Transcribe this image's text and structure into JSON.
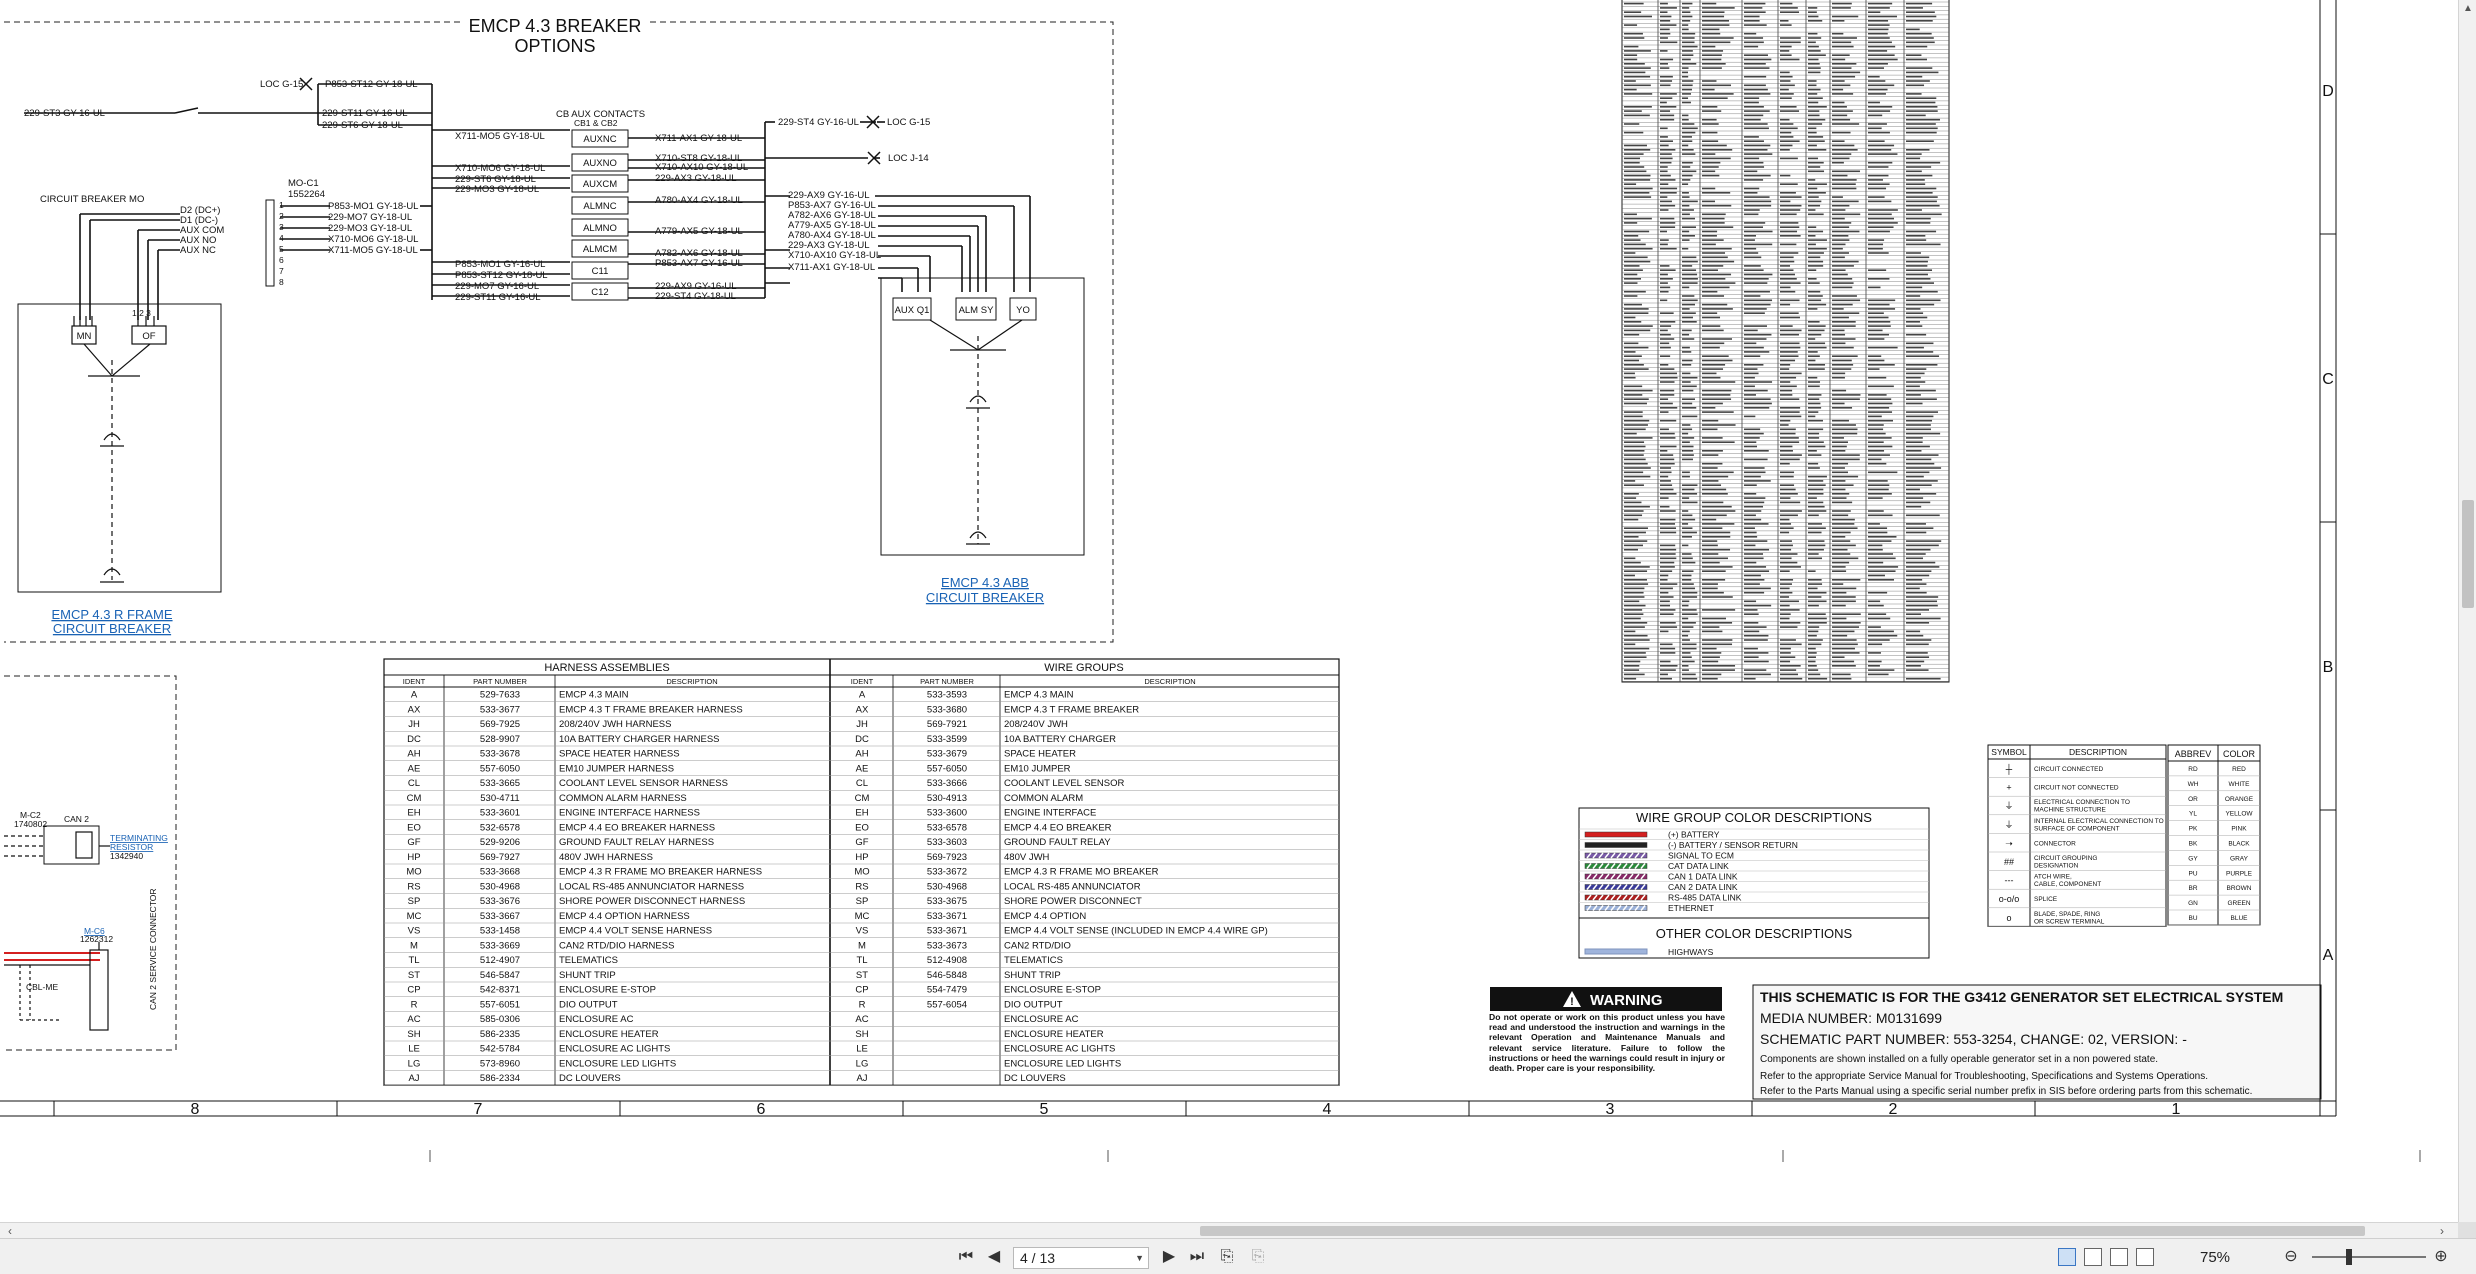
{
  "breaker_options": {
    "title_line1": "EMCP 4.3 BREAKER",
    "title_line2": "OPTIONS",
    "r_frame_link_line1": "EMCP 4.3 R FRAME",
    "r_frame_link_line2": "CIRCUIT BREAKER",
    "abb_link_line1": "EMCP 4.3 ABB",
    "abb_link_line2": "CIRCUIT BREAKER",
    "circuit_breaker_mo": "CIRCUIT BREAKER MO",
    "mo_c1_line1": "MO-C1",
    "mo_c1_line2": "1552264",
    "cb_aux_line1": "CB AUX CONTACTS",
    "cb_aux_line2": "CB1 & CB2",
    "loc_g15": "LOC G-15",
    "loc_j14": "LOC J-14",
    "mo_pins": [
      "D2 (DC+)",
      "D1 (DC-)",
      "AUX COM",
      "AUX NO",
      "AUX NC"
    ],
    "terminal_numbers": [
      "1",
      "2",
      "3",
      "4",
      "5",
      "6",
      "7",
      "8"
    ],
    "mo_wires": [
      "P853-MO1 GY-18-UL",
      "229-MO7 GY-18-UL",
      "229-MO3 GY-18-UL",
      "X710-MO6 GY-18-UL",
      "X711-MO5 GY-18-UL"
    ],
    "top_wires": [
      "P853-ST12 GY-18-UL",
      "229-ST11 GY-16-UL",
      "229-ST6 GY-18-UL",
      "229-ST3 GY-16-UL"
    ],
    "aux_boxes": [
      "AUXNC",
      "AUXNO",
      "AUXCM",
      "ALMNC",
      "ALMNO",
      "ALMCM",
      "C11",
      "C12"
    ],
    "left_aux_wires": [
      "X711-MO5 GY-18-UL",
      "X710-MO6 GY-18-UL",
      "229-ST6 GY-18-UL",
      "229-MO3 GY-18-UL",
      "P853-MO1 GY-16-UL",
      "P853-ST12 GY-18-UL",
      "229-MO7 GY-16-UL",
      "229-ST11 GY-16-UL"
    ],
    "right_aux_wires": [
      "X711-AX1 GY-18-UL",
      "X710-ST8 GY-18-UL",
      "X710-AX10 GY-18-UL",
      "229-AX3 GY-18-UL",
      "A780-AX4 GY-18-UL",
      "A779-AX5 GY-18-UL",
      "A782-AX6 GY-18-UL",
      "P853-AX7 GY-16-UL",
      "229-AX9 GY-16-UL",
      "229-ST4 GY-18-UL"
    ],
    "abb_wires": [
      "229-ST4 GY-16-UL",
      "229-AX9 GY-16-UL",
      "P853-AX7 GY-16-UL",
      "A782-AX6 GY-18-UL",
      "A779-AX5 GY-18-UL",
      "A780-AX4 GY-18-UL",
      "229-AX3 GY-18-UL",
      "X710-AX10 GY-18-UL",
      "X711-AX1 GY-18-UL"
    ],
    "mn_label": "MN",
    "of_label": "OF",
    "of_pins": "1 2 3",
    "aux_q1": "AUX Q1",
    "alm_sy": "ALM SY",
    "yo": "YO"
  },
  "left_partial": {
    "mc2_line1": "M-C2",
    "mc2_line2": "1740802",
    "can2": "CAN 2",
    "terminating_line1": "TERMINATING",
    "terminating_line2": "RESISTOR",
    "terminating_pn": "1342940",
    "m_c6": "M-C6",
    "m_c6_pn": "1262312",
    "cbl_me": "CBL-ME",
    "service_connector": "CAN 2 SERVICE CONNECTOR"
  },
  "harness": {
    "title_left": "HARNESS ASSEMBLIES",
    "title_right": "WIRE GROUPS",
    "headers": [
      "IDENT",
      "PART NUMBER",
      "DESCRIPTION",
      "IDENT",
      "PART NUMBER",
      "DESCRIPTION"
    ],
    "rows": [
      [
        "A",
        "529-7633",
        "EMCP 4.3 MAIN",
        "A",
        "533-3593",
        "EMCP 4.3 MAIN"
      ],
      [
        "AX",
        "533-3677",
        "EMCP 4.3 T FRAME BREAKER HARNESS",
        "AX",
        "533-3680",
        "EMCP 4.3 T FRAME BREAKER"
      ],
      [
        "JH",
        "569-7925",
        "208/240V JWH HARNESS",
        "JH",
        "569-7921",
        "208/240V JWH"
      ],
      [
        "DC",
        "528-9907",
        "10A BATTERY CHARGER HARNESS",
        "DC",
        "533-3599",
        "10A BATTERY CHARGER"
      ],
      [
        "AH",
        "533-3678",
        "SPACE HEATER HARNESS",
        "AH",
        "533-3679",
        "SPACE HEATER"
      ],
      [
        "AE",
        "557-6050",
        "EM10 JUMPER HARNESS",
        "AE",
        "557-6050",
        "EM10 JUMPER"
      ],
      [
        "CL",
        "533-3665",
        "COOLANT LEVEL SENSOR HARNESS",
        "CL",
        "533-3666",
        "COOLANT LEVEL SENSOR"
      ],
      [
        "CM",
        "530-4711",
        "COMMON ALARM HARNESS",
        "CM",
        "530-4913",
        "COMMON ALARM"
      ],
      [
        "EH",
        "533-3601",
        "ENGINE INTERFACE HARNESS",
        "EH",
        "533-3600",
        "ENGINE INTERFACE"
      ],
      [
        "EO",
        "532-6578",
        "EMCP 4.4 EO BREAKER HARNESS",
        "EO",
        "533-6578",
        "EMCP 4.4 EO BREAKER"
      ],
      [
        "GF",
        "529-9206",
        "GROUND FAULT RELAY HARNESS",
        "GF",
        "533-3603",
        "GROUND FAULT RELAY"
      ],
      [
        "HP",
        "569-7927",
        "480V JWH HARNESS",
        "HP",
        "569-7923",
        "480V JWH"
      ],
      [
        "MO",
        "533-3668",
        "EMCP 4.3 R FRAME MO BREAKER HARNESS",
        "MO",
        "533-3672",
        "EMCP 4.3 R FRAME MO BREAKER"
      ],
      [
        "RS",
        "530-4968",
        "LOCAL RS-485 ANNUNCIATOR HARNESS",
        "RS",
        "530-4968",
        "LOCAL RS-485 ANNUNCIATOR"
      ],
      [
        "SP",
        "533-3676",
        "SHORE POWER DISCONNECT HARNESS",
        "SP",
        "533-3675",
        "SHORE POWER DISCONNECT"
      ],
      [
        "MC",
        "533-3667",
        "EMCP 4.4 OPTION HARNESS",
        "MC",
        "533-3671",
        "EMCP 4.4 OPTION"
      ],
      [
        "VS",
        "533-1458",
        "EMCP 4.4 VOLT SENSE HARNESS",
        "VS",
        "533-3671",
        "EMCP 4.4 VOLT SENSE (INCLUDED IN EMCP 4.4 WIRE GP)"
      ],
      [
        "M",
        "533-3669",
        "CAN2 RTD/DIO HARNESS",
        "M",
        "533-3673",
        "CAN2 RTD/DIO"
      ],
      [
        "TL",
        "512-4907",
        "TELEMATICS",
        "TL",
        "512-4908",
        "TELEMATICS"
      ],
      [
        "ST",
        "546-5847",
        "SHUNT TRIP",
        "ST",
        "546-5848",
        "SHUNT TRIP"
      ],
      [
        "CP",
        "542-8371",
        "ENCLOSURE E-STOP",
        "CP",
        "554-7479",
        "ENCLOSURE E-STOP"
      ],
      [
        "R",
        "557-6051",
        "DIO OUTPUT",
        "R",
        "557-6054",
        "DIO OUTPUT"
      ],
      [
        "AC",
        "585-0306",
        "ENCLOSURE AC",
        "AC",
        "",
        "ENCLOSURE AC"
      ],
      [
        "SH",
        "586-2335",
        "ENCLOSURE HEATER",
        "SH",
        "",
        "ENCLOSURE HEATER"
      ],
      [
        "LE",
        "542-5784",
        "ENCLOSURE AC LIGHTS",
        "LE",
        "",
        "ENCLOSURE AC LIGHTS"
      ],
      [
        "LG",
        "573-8960",
        "ENCLOSURE LED LIGHTS",
        "LG",
        "",
        "ENCLOSURE LED LIGHTS"
      ],
      [
        "AJ",
        "586-2334",
        "DC LOUVERS",
        "AJ",
        "",
        "DC LOUVERS"
      ]
    ]
  },
  "wire_colors": {
    "title": "WIRE GROUP COLOR DESCRIPTIONS",
    "items": [
      {
        "label": "(+) BATTERY",
        "color": "#d42020",
        "pattern": "solid"
      },
      {
        "label": "(-) BATTERY / SENSOR RETURN",
        "color": "#222222",
        "pattern": "solid"
      },
      {
        "label": "SIGNAL TO ECM",
        "color": "#7a5aa8",
        "pattern": "hatch"
      },
      {
        "label": "CAT DATA LINK",
        "color": "#2a8a3a",
        "pattern": "hatch"
      },
      {
        "label": "CAN 1 DATA LINK",
        "color": "#8a2a6a",
        "pattern": "hatch"
      },
      {
        "label": "CAN 2 DATA LINK",
        "color": "#3a3a9a",
        "pattern": "hatch"
      },
      {
        "label": "RS-485 DATA LINK",
        "color": "#b02020",
        "pattern": "hatch"
      },
      {
        "label": "ETHERNET",
        "color": "#9ab0d8",
        "pattern": "hatch"
      }
    ],
    "other_title": "OTHER COLOR DESCRIPTIONS",
    "other_items": [
      {
        "label": "HIGHWAYS",
        "color": "#9fb4dc"
      }
    ]
  },
  "symbols": {
    "headers": [
      "SYMBOL",
      "DESCRIPTION"
    ],
    "rows": [
      {
        "glyph": "┼",
        "desc": "CIRCUIT CONNECTED"
      },
      {
        "glyph": "+",
        "desc": "CIRCUIT NOT CONNECTED"
      },
      {
        "glyph": "⏚",
        "desc": "ELECTRICAL CONNECTION TO MACHINE STRUCTURE"
      },
      {
        "glyph": "⏚",
        "desc": "INTERNAL ELECTRICAL CONNECTION TO SURFACE OF COMPONENT"
      },
      {
        "glyph": "➝",
        "desc": "CONNECTOR"
      },
      {
        "glyph": "##",
        "desc": "CIRCUIT GROUPING DESIGNATION"
      },
      {
        "glyph": "---",
        "desc": "ATCH WIRE, CABLE, COMPONENT"
      },
      {
        "glyph": "o-o/o",
        "desc": "SPLICE"
      },
      {
        "glyph": "o",
        "desc": "BLADE, SPADE, RING OR SCREW TERMINAL"
      }
    ]
  },
  "abbrev": {
    "headers": [
      "ABBREV",
      "COLOR"
    ],
    "rows": [
      [
        "RD",
        "RED"
      ],
      [
        "WH",
        "WHITE"
      ],
      [
        "OR",
        "ORANGE"
      ],
      [
        "YL",
        "YELLOW"
      ],
      [
        "PK",
        "PINK"
      ],
      [
        "BK",
        "BLACK"
      ],
      [
        "GY",
        "GRAY"
      ],
      [
        "PU",
        "PURPLE"
      ],
      [
        "BR",
        "BROWN"
      ],
      [
        "GN",
        "GREEN"
      ],
      [
        "BU",
        "BLUE"
      ]
    ]
  },
  "warning": {
    "title": "WARNING",
    "text": "Do not operate or work on this product unless you have read and understood the instruction and warnings in the relevant Operation and Maintenance Manuals and relevant service literature. Failure to follow the instructions or heed the warnings could result in injury or death. Proper care is your responsibility."
  },
  "title_block": {
    "headline": "THIS SCHEMATIC IS FOR THE G3412 GENERATOR SET ELECTRICAL SYSTEM",
    "media": "MEDIA NUMBER: M0131699",
    "part": "SCHEMATIC PART NUMBER: 553-3254, CHANGE: 02, VERSION: -",
    "note1": "Components are shown installed on a fully operable generator set in a non powered state.",
    "note2": "Refer to the appropriate Service Manual for Troubleshooting, Specifications and Systems Operations.",
    "note3": "Refer to the Parts Manual using a specific serial number prefix in SIS before ordering parts from this schematic."
  },
  "grid": {
    "columns": [
      "8",
      "7",
      "6",
      "5",
      "4",
      "3",
      "2",
      "1"
    ],
    "rows": [
      "D",
      "C",
      "B",
      "A"
    ]
  },
  "viewer": {
    "page_value": "4 / 13",
    "zoom": "75%"
  }
}
